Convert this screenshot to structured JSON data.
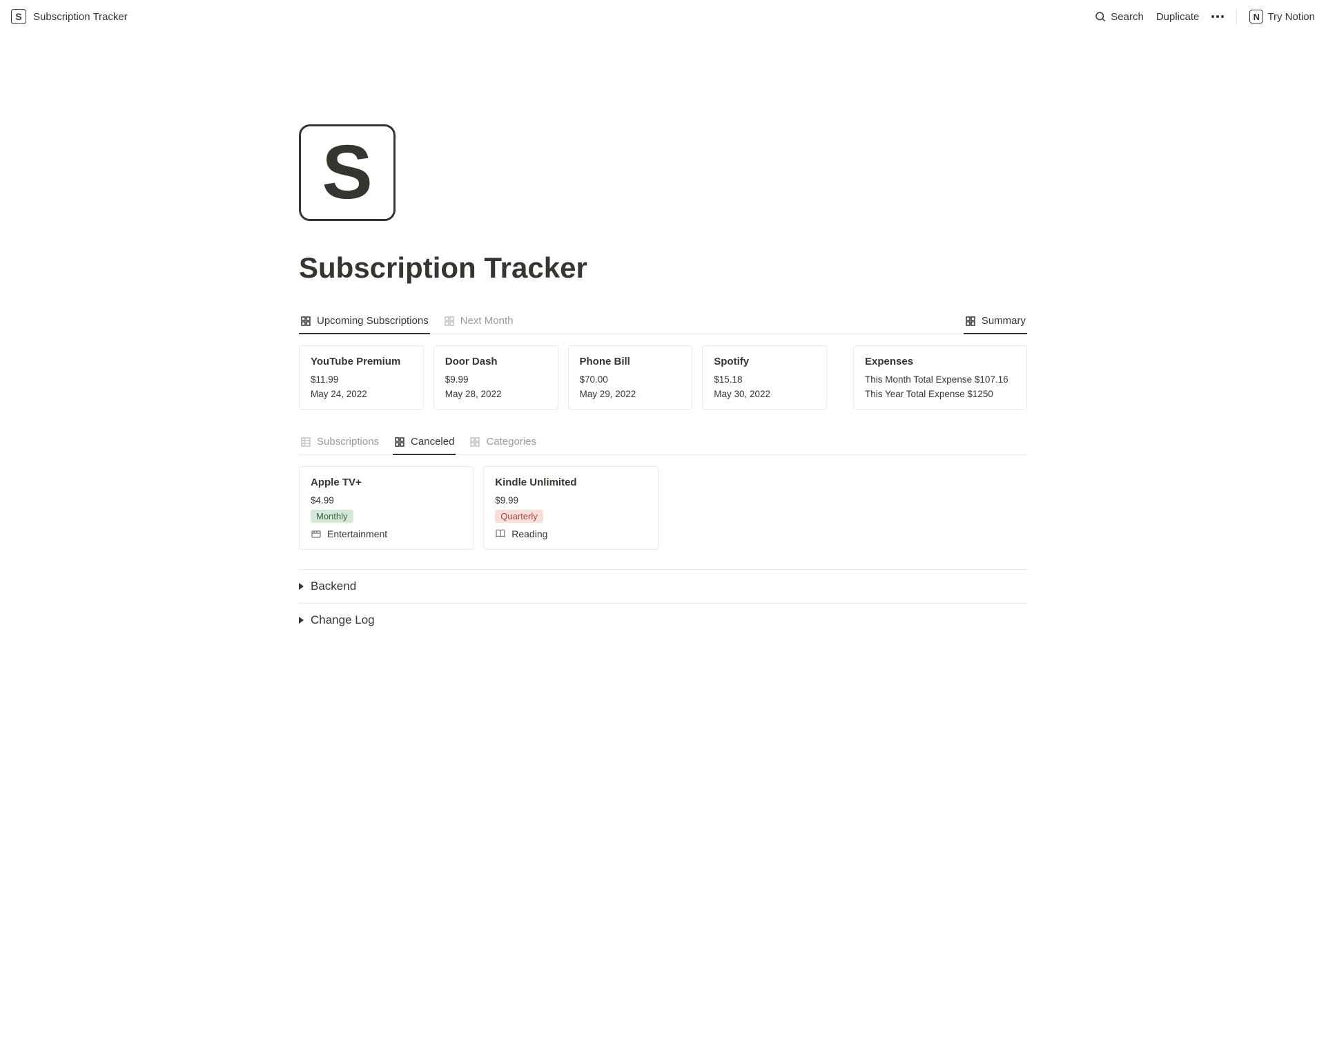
{
  "topbar": {
    "icon_letter": "S",
    "title": "Subscription Tracker",
    "search": "Search",
    "duplicate": "Duplicate",
    "try_notion": "Try Notion",
    "notion_letter": "N"
  },
  "page": {
    "icon_letter": "S",
    "title": "Subscription Tracker"
  },
  "upcomingTabs": {
    "upcoming": "Upcoming Subscriptions",
    "nextMonth": "Next Month",
    "summary": "Summary"
  },
  "upcoming": [
    {
      "name": "YouTube Premium",
      "price": "$11.99",
      "date": "May 24, 2022"
    },
    {
      "name": "Door Dash",
      "price": "$9.99",
      "date": "May 28, 2022"
    },
    {
      "name": "Phone Bill",
      "price": "$70.00",
      "date": "May 29, 2022"
    },
    {
      "name": "Spotify",
      "price": "$15.18",
      "date": "May 30, 2022"
    }
  ],
  "summary": {
    "title": "Expenses",
    "month": "This Month Total Expense $107.16",
    "year": "This Year Total Expense $1250"
  },
  "secondTabs": {
    "subscriptions": "Subscriptions",
    "canceled": "Canceled",
    "categories": "Categories"
  },
  "canceled": [
    {
      "name": "Apple TV+",
      "price": "$4.99",
      "cycle": "Monthly",
      "cycleColor": "green",
      "category": "Entertainment"
    },
    {
      "name": "Kindle Unlimited",
      "price": "$9.99",
      "cycle": "Quarterly",
      "cycleColor": "red",
      "category": "Reading"
    }
  ],
  "toggles": {
    "backend": "Backend",
    "changelog": "Change Log"
  }
}
